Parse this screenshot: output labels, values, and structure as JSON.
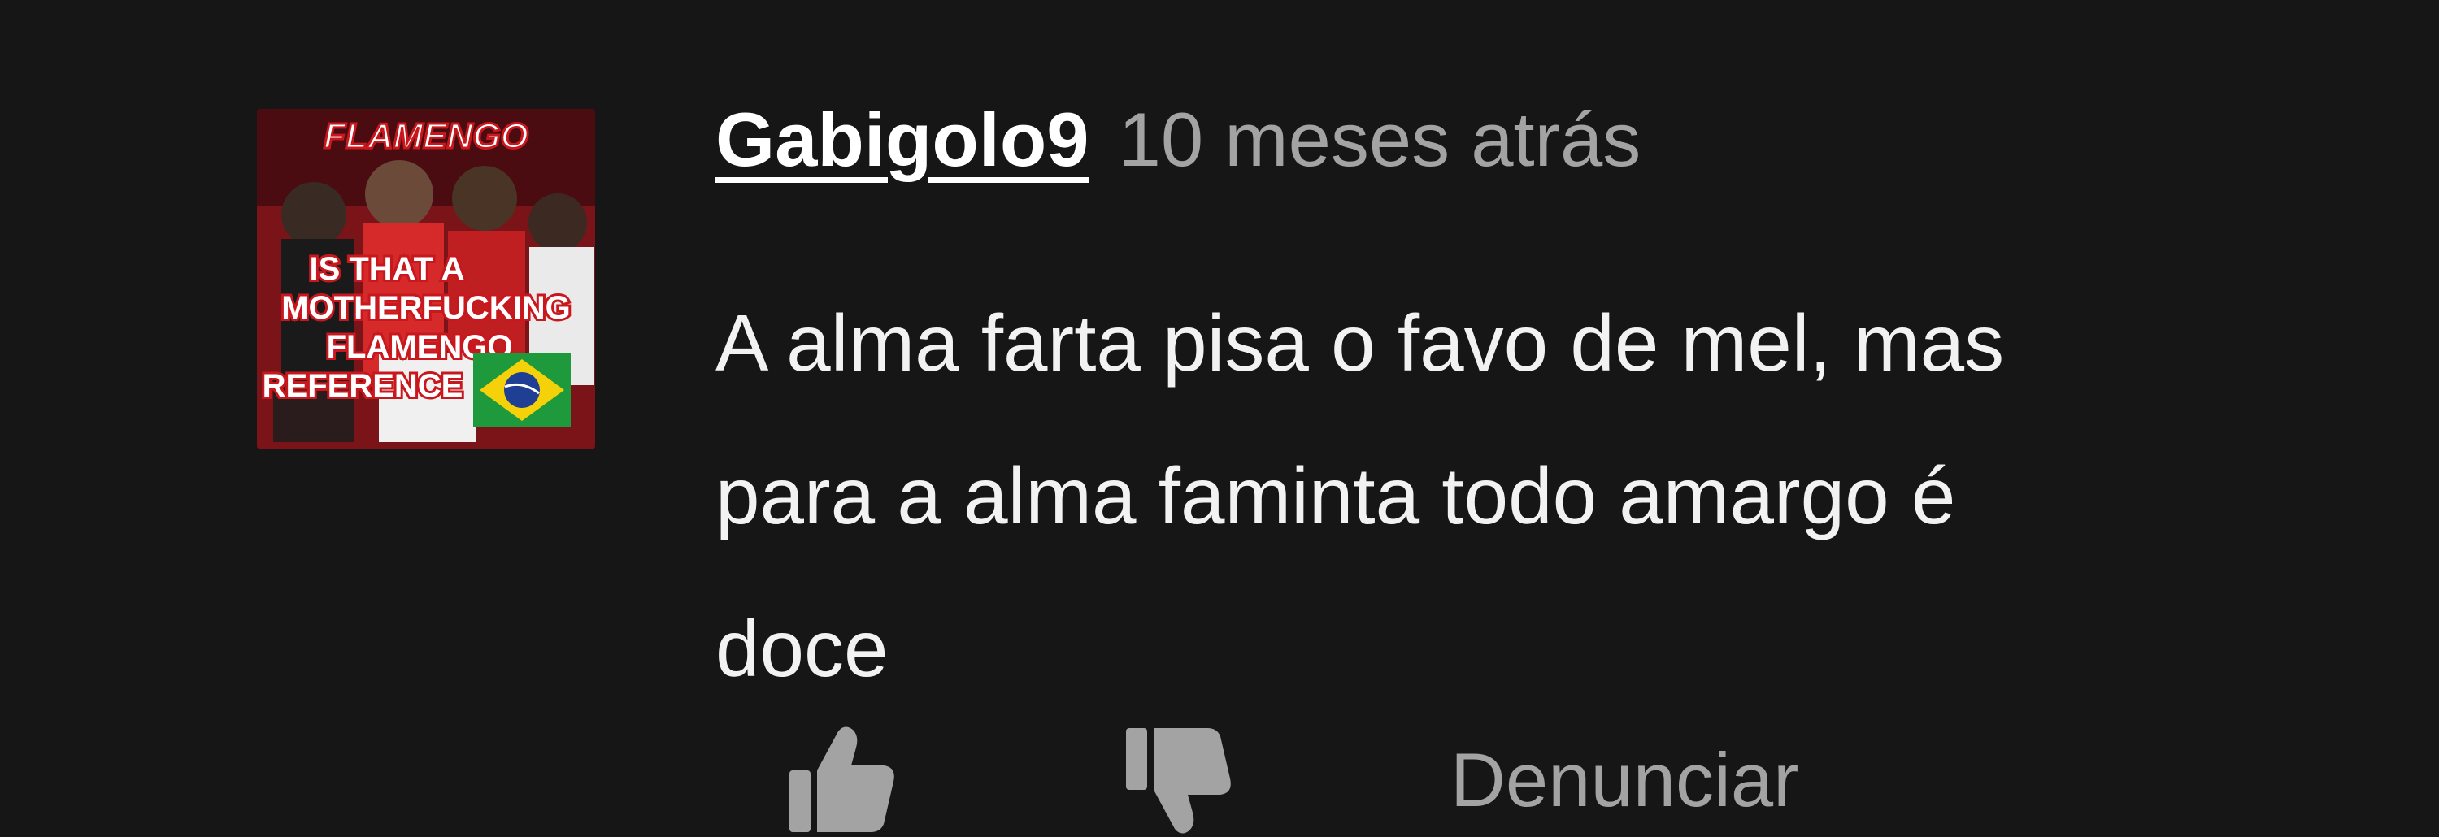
{
  "comment": {
    "author": "Gabigolo9",
    "timestamp": "10 meses atrás",
    "lines": [
      "A alma farta pisa o favo de mel, mas",
      "para a alma faminta todo amargo é",
      "doce"
    ],
    "avatar": {
      "title": "FLAMENGO",
      "caption_lines": [
        "IS THAT A",
        "MOTHERFUCKING",
        "FLAMENGO",
        "REFERENCE"
      ],
      "icons": [
        "brazil-flag-icon"
      ]
    }
  },
  "actions": {
    "like_icon": "thumbs-up-icon",
    "dislike_icon": "thumbs-down-icon",
    "report_label": "Denunciar"
  },
  "colors": {
    "background": "#161616",
    "text": "#f2f2f2",
    "muted": "#a3a3a3",
    "avatar_red": "#c8181e",
    "flag_green": "#1e9a3c",
    "flag_yellow": "#f5d10a",
    "flag_blue": "#1f3f94"
  }
}
